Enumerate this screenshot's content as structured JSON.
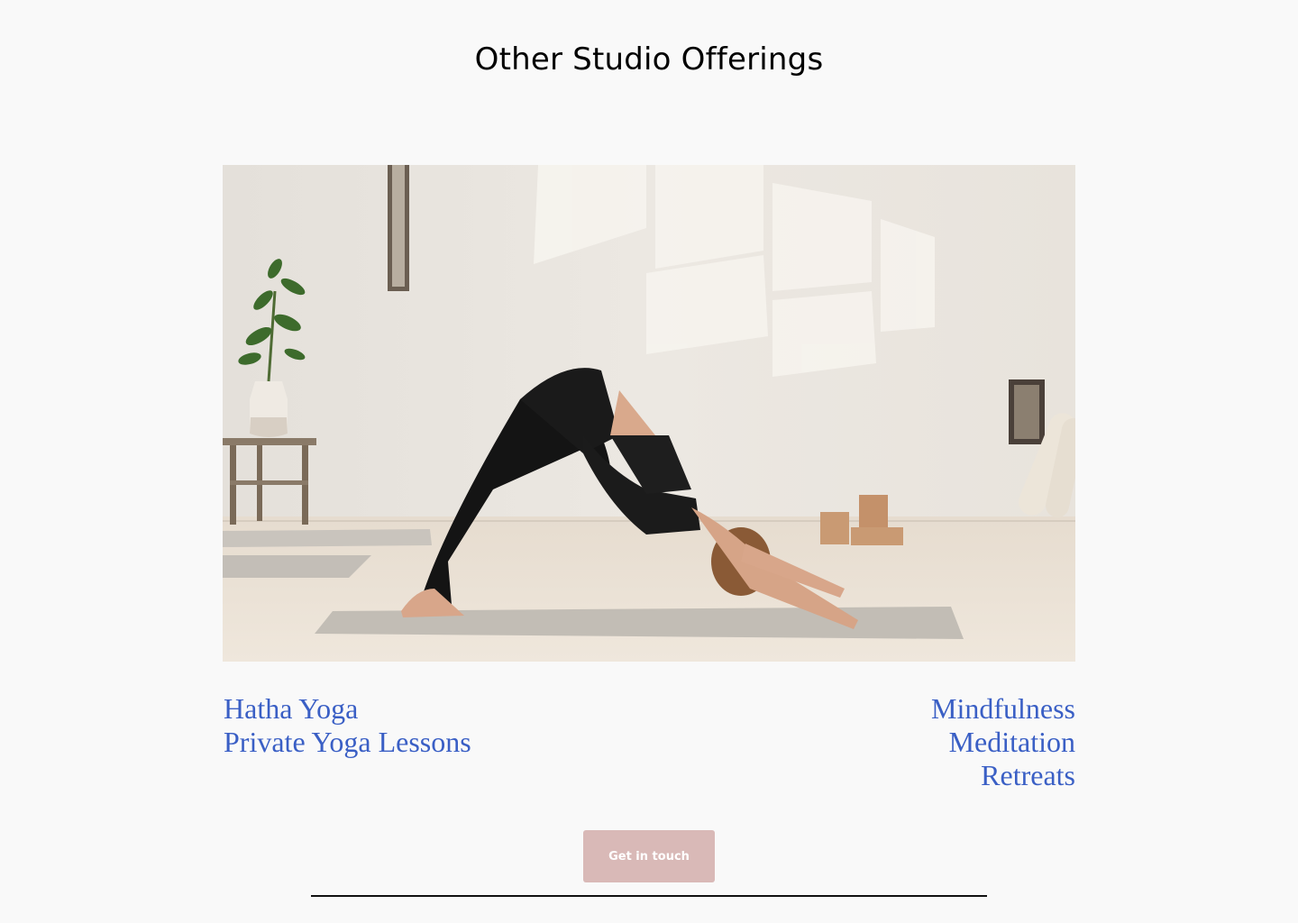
{
  "header": {
    "title": "Other Studio Offerings"
  },
  "hero_image": {
    "subject": "woman in downward dog yoga pose on a mat in a bright studio"
  },
  "offerings": {
    "left": [
      "Hatha Yoga",
      "Private Yoga Lessons"
    ],
    "right": [
      "Mindfulness",
      "Meditation",
      "Retreats"
    ]
  },
  "cta": {
    "label": "Get in touch"
  },
  "colors": {
    "background": "#f9f9f9",
    "link": "#3a5fc5",
    "button": "#d9b9b7",
    "title": "#000000"
  }
}
